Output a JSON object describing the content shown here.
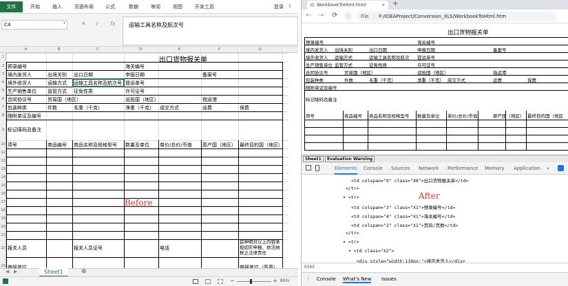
{
  "excel": {
    "ribbon": {
      "file": "文件",
      "tabs": [
        "开始",
        "插入",
        "页面布局",
        "公式",
        "数据",
        "审阅",
        "视图",
        "开发工具"
      ],
      "login": "登录"
    },
    "namebox": "C4",
    "formula": "运输工具名称及航次号",
    "col_headers": [
      "A",
      "B",
      "C",
      "D",
      "E",
      "F",
      "G"
    ],
    "row_headers": [
      "1",
      "2",
      "3",
      "4",
      "5",
      "6",
      "7",
      "8",
      "9",
      "10",
      "11",
      "12",
      "13",
      "14",
      "15",
      "16",
      "17",
      "18",
      "19",
      "20",
      "21",
      "22",
      "23",
      "24",
      "25",
      "26",
      "27"
    ],
    "sheet": {
      "title": "出口货物报关单",
      "r2": [
        "预录编号",
        "",
        "海关编号"
      ],
      "r3": [
        "境内发货人",
        "出境关别",
        "出口日期",
        "申报日期",
        "备案号"
      ],
      "r4": [
        "境外收货人",
        "运输方式",
        "运输工具名称及航次号",
        "提运单号"
      ],
      "r5": [
        "生产销售单位",
        "监管方式",
        "征免性质",
        "许可证号"
      ],
      "r6": [
        "合同协议号",
        "贸易国（地区）",
        "运抵国（地区）",
        "指运港"
      ],
      "r7": [
        "包装种类",
        "件数",
        "毛重（千克）",
        "净重（千克）",
        "成交方式",
        "运费",
        "保费"
      ],
      "r8": [
        "随附单证及编号"
      ],
      "r9": [
        "标记唛码及备注"
      ],
      "r10": [
        "项号",
        "商品编号",
        "商品名称及规格型号",
        "数量及单位",
        "单价/总价/币值",
        "原产国（地区）",
        "最终目的国（地区）"
      ],
      "r_decl": [
        "报关人员",
        "报关人员证号",
        "电话",
        "兹申明对以上内容承担如实申报、依法纳税之法律责任"
      ],
      "r_unit": [
        "申报单位",
        "申报单位（签章）"
      ]
    },
    "before_label": "Before",
    "sheet_tab": "Sheet1",
    "zoom": "85%"
  },
  "browser": {
    "tab_title": "WorkbookToHtml.html",
    "url_prefix": "File",
    "url": "F:/IDEAProject/Conversion_XLS/WorkbookToHtml.htm",
    "page": {
      "title": "出口货物报关单",
      "r1": [
        "预录编号",
        "海关编号"
      ],
      "r2": [
        "境内发货人",
        "出境关别",
        "出口日期",
        "申报日期",
        "备案号"
      ],
      "r3": [
        "境外收货人",
        "运输方式",
        "运输工具名称及航次",
        "提运单号"
      ],
      "r4": [
        "生产销售单位",
        "监管方式",
        "征免性质",
        "许可证号"
      ],
      "r5": [
        "合同协议号",
        "贸易国（地区）",
        "运抵国（地区）",
        "指运港"
      ],
      "r6": [
        "包装种类",
        "件数",
        "毛重（千克）",
        "净重（千克）",
        "成交方式",
        "运费",
        "保费"
      ],
      "r7": [
        "随附单证及编号"
      ],
      "r8": [
        "标记唛码及备注"
      ],
      "r9": [
        "项号",
        "商品编号",
        "商品名称及规格型号",
        "数量及单位",
        "单价/总价/币值",
        "原产国（地区）",
        "最终目的国（地区"
      ]
    },
    "sheet_label": "Sheet1",
    "eval_warning": "Evaluation Warning",
    "devtools": {
      "tabs": [
        "Elements",
        "Console",
        "Sources",
        "Network",
        "Performance",
        "Memory",
        "Application"
      ],
      "lines": [
        "<td colspan=\"9\" class=\"X0\">出口货物报关单</td>",
        "</tr>",
        "▾ <tr>",
        "<td colspan=\"3\" class=\"X1\">预录编号</td>",
        "<td colspan=\"4\" class=\"X1\">海关编号</td>",
        "<td colspan=\"2\" class=\"X1\">页码/页数</td>",
        "</tr>",
        "▾ <tr>",
        "▾ <td class=\"X2\">",
        "<div style=\"width:110px;\">境内发货人</div>"
      ],
      "breadcrumb": "html",
      "drawer_tabs": [
        "Console",
        "What's New",
        "Issues"
      ]
    },
    "after_label": "After"
  }
}
